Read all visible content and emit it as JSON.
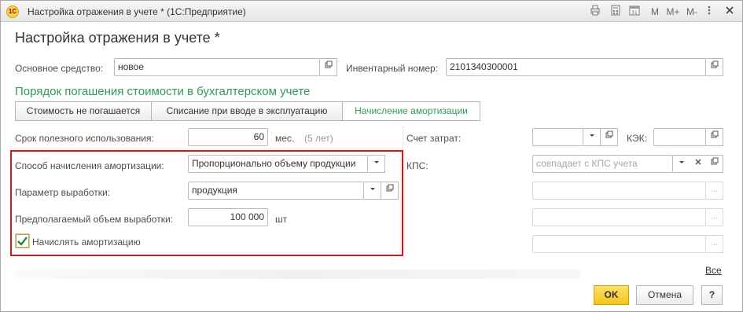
{
  "window": {
    "title": "Настройка отражения в учете * (1С:Предприятие)",
    "logo_text": "1С",
    "toolbar": {
      "m": "M",
      "m_plus": "M+",
      "m_minus": "M-"
    }
  },
  "form": {
    "title": "Настройка отражения в учете *",
    "asset_label": "Основное средство:",
    "asset_value": "новое",
    "inventory_label": "Инвентарный номер:",
    "inventory_value": "2101340300001",
    "section_title": "Порядок погашения стоимости в бухгалтерском учете",
    "mode_buttons": [
      "Стоимость не погашается",
      "Списание при вводе в эксплуатацию",
      "Начисление амортизации"
    ],
    "useful_life_label": "Срок полезного использования:",
    "useful_life_value": "60",
    "useful_life_unit": "мес.",
    "useful_life_years": "(5 лет)",
    "method_label": "Способ начисления амортизации:",
    "method_value": "Пропорционально объему продукции",
    "param_label": "Параметр выработки:",
    "param_value": "продукция",
    "volume_label": "Предполагаемый объем выработки:",
    "volume_value": "100 000",
    "volume_unit": "шт",
    "accrue_label": "Начислять амортизацию",
    "accrue_checked": true,
    "cost_account_label": "Счет затрат:",
    "kek_label": "КЭК:",
    "kps_label": "КПС:",
    "kps_placeholder": "совпадает с КПС учета",
    "all_link": "Все",
    "ok_button": "OK",
    "cancel_button": "Отмена",
    "help_button": "?"
  },
  "colors": {
    "section_green": "#2f9a56",
    "highlight_red": "#e0101e",
    "ok_yellow": "#f7d23b"
  }
}
